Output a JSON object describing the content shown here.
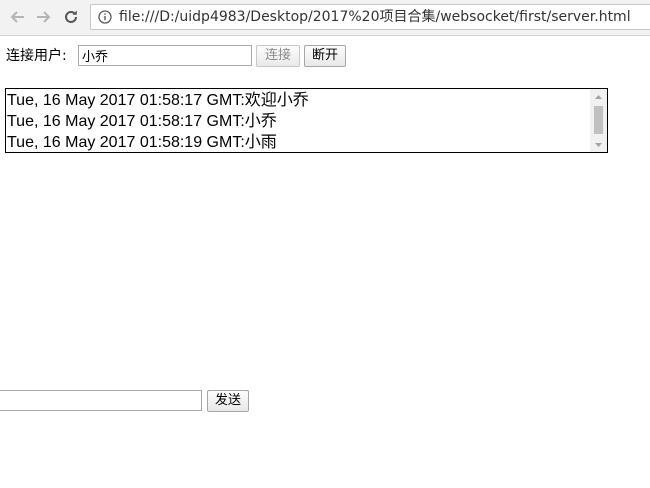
{
  "browser": {
    "url": "file:///D:/uidp4983/Desktop/2017%20项目合集/websocket/first/server.html"
  },
  "form": {
    "user_label": "连接用户:",
    "user_value": "小乔",
    "connect_label": "连接",
    "disconnect_label": "断开",
    "message_value": "",
    "send_label": "发送"
  },
  "log": {
    "lines": [
      "Tue, 16 May 2017 01:58:17 GMT:欢迎小乔",
      "Tue, 16 May 2017 01:58:17 GMT:小乔",
      "Tue, 16 May 2017 01:58:19 GMT:小雨"
    ]
  }
}
